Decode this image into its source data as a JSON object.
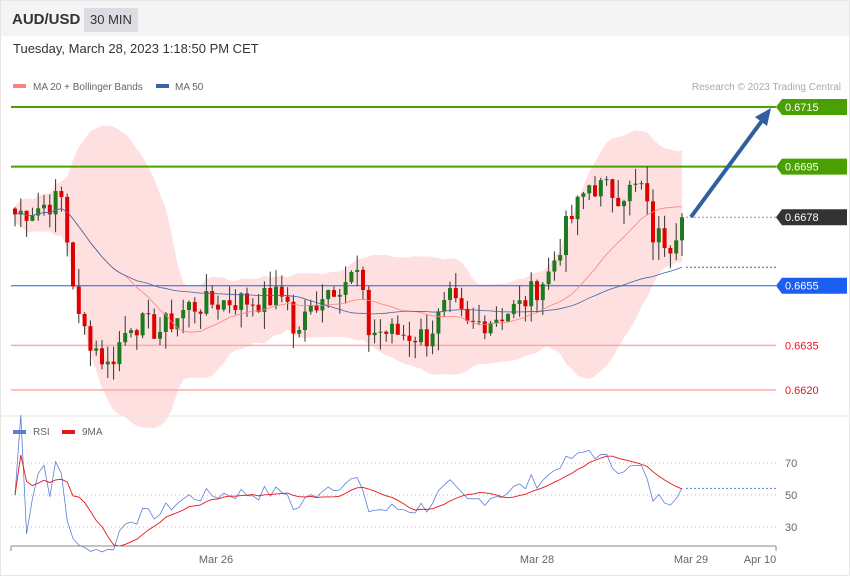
{
  "header": {
    "symbol": "AUD/USD",
    "timeframe": "30 MIN",
    "datetime": "Tuesday, March 28, 2023 1:18:50 PM CET"
  },
  "legend": {
    "ma20": "MA 20 + Bollinger Bands",
    "ma50": "MA 50",
    "credit": "Research © 2023 Trading Central"
  },
  "rsi_legend": {
    "rsi": "RSI",
    "ma": "9MA"
  },
  "colors": {
    "green": "#4aa000",
    "blue": "#1a5ff0",
    "dark": "#333333",
    "red": "#e8141c",
    "bull": "#1e7a1e",
    "bear": "#e00000",
    "band": "#ffe0e0",
    "ma50": "#3b64a8",
    "rsi": "#5b7fd8"
  },
  "chart_data": {
    "type": "candlestick",
    "title": "AUD/USD 30 MIN",
    "levels": [
      {
        "value": 0.6715,
        "label": "0.6715",
        "kind": "resistance"
      },
      {
        "value": 0.6695,
        "label": "0.6695",
        "kind": "resistance"
      },
      {
        "value": 0.6678,
        "label": "0.6678",
        "kind": "last"
      },
      {
        "value": 0.6655,
        "label": "0.6655",
        "kind": "pivot"
      },
      {
        "value": 0.6635,
        "label": "0.6635",
        "kind": "support"
      },
      {
        "value": 0.662,
        "label": "0.6620",
        "kind": "support"
      }
    ],
    "close_keypoints": [
      [
        0,
        0.6679
      ],
      [
        8,
        0.6684
      ],
      [
        11,
        0.6643
      ],
      [
        16,
        0.6628
      ],
      [
        20,
        0.6643
      ],
      [
        25,
        0.664
      ],
      [
        30,
        0.6648
      ],
      [
        37,
        0.665
      ],
      [
        42,
        0.665
      ],
      [
        47,
        0.6652
      ],
      [
        48,
        0.6638
      ],
      [
        53,
        0.6653
      ],
      [
        59,
        0.6659
      ],
      [
        61,
        0.664
      ],
      [
        71,
        0.6638
      ],
      [
        75,
        0.665
      ],
      [
        78,
        0.6641
      ],
      [
        87,
        0.6648
      ],
      [
        92,
        0.6659
      ],
      [
        95,
        0.6674
      ],
      [
        99,
        0.6689
      ],
      [
        104,
        0.6686
      ],
      [
        108,
        0.6688
      ],
      [
        110,
        0.6672
      ],
      [
        113,
        0.667
      ],
      [
        115,
        0.6678
      ]
    ],
    "candles": 116,
    "x_ticks": [
      "Mar 26",
      "Mar 28",
      "Mar 29",
      "Apr 10"
    ],
    "rsi_ticks": [
      "70",
      "50",
      "30"
    ],
    "rsi_range": [
      0,
      100
    ]
  }
}
